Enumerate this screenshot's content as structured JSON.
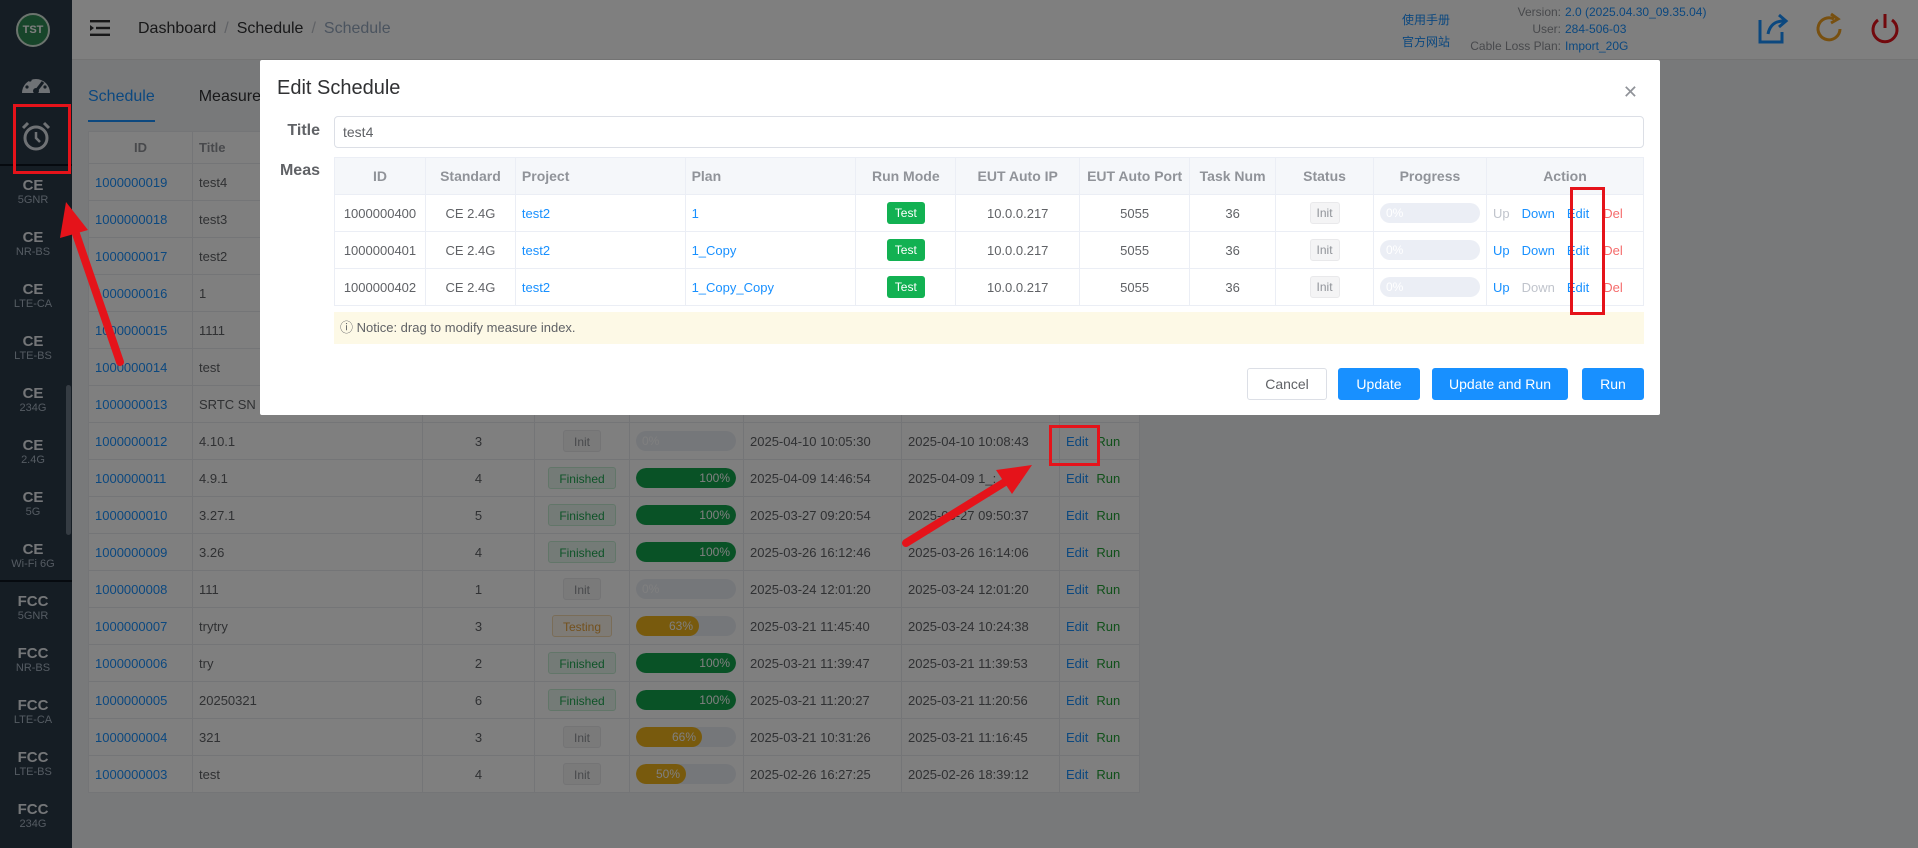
{
  "logo_text": "TST",
  "sidebar": {
    "items": [
      {
        "title": "CE",
        "sub": "5GNR"
      },
      {
        "title": "CE",
        "sub": "NR-BS"
      },
      {
        "title": "CE",
        "sub": "LTE-CA"
      },
      {
        "title": "CE",
        "sub": "LTE-BS"
      },
      {
        "title": "CE",
        "sub": "234G"
      },
      {
        "title": "CE",
        "sub": "2.4G"
      },
      {
        "title": "CE",
        "sub": "5G"
      },
      {
        "title": "CE",
        "sub": "Wi-Fi 6G"
      },
      {
        "title": "FCC",
        "sub": "5GNR"
      },
      {
        "title": "FCC",
        "sub": "NR-BS"
      },
      {
        "title": "FCC",
        "sub": "LTE-CA"
      },
      {
        "title": "FCC",
        "sub": "LTE-BS"
      },
      {
        "title": "FCC",
        "sub": "234G"
      }
    ]
  },
  "header": {
    "breadcrumb": [
      "Dashboard",
      "Schedule",
      "Schedule"
    ],
    "manual_link": "使用手册",
    "official_site_link": "官方网站",
    "version_label": "Version:",
    "version_value": "2.0 (2025.04.30_09.35.04)",
    "user_label": "User:",
    "user_value": "284-506-03",
    "cable_label": "Cable Loss Plan:",
    "cable_value": "Import_20G"
  },
  "tabs": [
    "Schedule",
    "Measure"
  ],
  "bg_table": {
    "headers": [
      "ID",
      "Title"
    ],
    "rows": [
      {
        "id": "1000000019",
        "title": "test4"
      },
      {
        "id": "1000000018",
        "title": "test3"
      },
      {
        "id": "1000000017",
        "title": "test2"
      },
      {
        "id": "1000000016",
        "title": "1"
      },
      {
        "id": "1000000015",
        "title": "1111"
      },
      {
        "id": "1000000014",
        "title": "test"
      },
      {
        "id": "1000000013",
        "title": "SRTC SN"
      },
      {
        "id": "1000000012",
        "title": "4.10.1",
        "count": "3",
        "status": "Init",
        "progress": "0%",
        "pct": 0,
        "start": "2025-04-10 10:05:30",
        "end": "2025-04-10 10:08:43"
      },
      {
        "id": "1000000011",
        "title": "4.9.1",
        "count": "4",
        "status": "Finished",
        "progress": "100%",
        "pct": 100,
        "start": "2025-04-09 14:46:54",
        "end": "2025-04-09 1_:_:11"
      },
      {
        "id": "1000000010",
        "title": "3.27.1",
        "count": "5",
        "status": "Finished",
        "progress": "100%",
        "pct": 100,
        "start": "2025-03-27 09:20:54",
        "end": "2025-03-27 09:50:37"
      },
      {
        "id": "1000000009",
        "title": "3.26",
        "count": "4",
        "status": "Finished",
        "progress": "100%",
        "pct": 100,
        "start": "2025-03-26 16:12:46",
        "end": "2025-03-26 16:14:06"
      },
      {
        "id": "1000000008",
        "title": "111",
        "count": "1",
        "status": "Init",
        "progress": "0%",
        "pct": 0,
        "start": "2025-03-24 12:01:20",
        "end": "2025-03-24 12:01:20"
      },
      {
        "id": "1000000007",
        "title": "trytry",
        "count": "3",
        "status": "Testing",
        "progress": "63%",
        "pct": 63,
        "start": "2025-03-21 11:45:40",
        "end": "2025-03-24 10:24:38"
      },
      {
        "id": "1000000006",
        "title": "try",
        "count": "2",
        "status": "Finished",
        "progress": "100%",
        "pct": 100,
        "start": "2025-03-21 11:39:47",
        "end": "2025-03-21 11:39:53"
      },
      {
        "id": "1000000005",
        "title": "20250321",
        "count": "6",
        "status": "Finished",
        "progress": "100%",
        "pct": 100,
        "start": "2025-03-21 11:20:27",
        "end": "2025-03-21 11:20:56"
      },
      {
        "id": "1000000004",
        "title": "321",
        "count": "3",
        "status": "Init",
        "progress": "66%",
        "pct": 66,
        "start": "2025-03-21 10:31:26",
        "end": "2025-03-21 11:16:45"
      },
      {
        "id": "1000000003",
        "title": "test",
        "count": "4",
        "status": "Init",
        "progress": "50%",
        "pct": 50,
        "start": "2025-02-26 16:27:25",
        "end": "2025-02-26 18:39:12"
      }
    ],
    "edit_label": "Edit",
    "run_label": "Run"
  },
  "dialog": {
    "title": "Edit Schedule",
    "title_label": "Title",
    "title_value": "test4",
    "meas_label": "Meas",
    "headers": [
      "ID",
      "Standard",
      "Project",
      "Plan",
      "Run Mode",
      "EUT Auto IP",
      "EUT Auto Port",
      "Task Num",
      "Status",
      "Progress",
      "Action"
    ],
    "rows": [
      {
        "id": "1000000400",
        "standard": "CE 2.4G",
        "project": "test2",
        "plan": "1",
        "run_mode": "Test",
        "ip": "10.0.0.217",
        "port": "5055",
        "tasks": "36",
        "status": "Init",
        "progress": "0%"
      },
      {
        "id": "1000000401",
        "standard": "CE 2.4G",
        "project": "test2",
        "plan": "1_Copy",
        "run_mode": "Test",
        "ip": "10.0.0.217",
        "port": "5055",
        "tasks": "36",
        "status": "Init",
        "progress": "0%"
      },
      {
        "id": "1000000402",
        "standard": "CE 2.4G",
        "project": "test2",
        "plan": "1_Copy_Copy",
        "run_mode": "Test",
        "ip": "10.0.0.217",
        "port": "5055",
        "tasks": "36",
        "status": "Init",
        "progress": "0%"
      }
    ],
    "actions": {
      "up": "Up",
      "down": "Down",
      "edit": "Edit",
      "del": "Del"
    },
    "notice": "ⓘ Notice: drag to modify measure index.",
    "buttons": {
      "cancel": "Cancel",
      "update": "Update",
      "update_run": "Update and Run",
      "run": "Run"
    }
  },
  "colors": {
    "primary": "#1890ff",
    "success": "#12b152",
    "annotation": "#e5131a",
    "sidebar": "#2b3a49"
  }
}
